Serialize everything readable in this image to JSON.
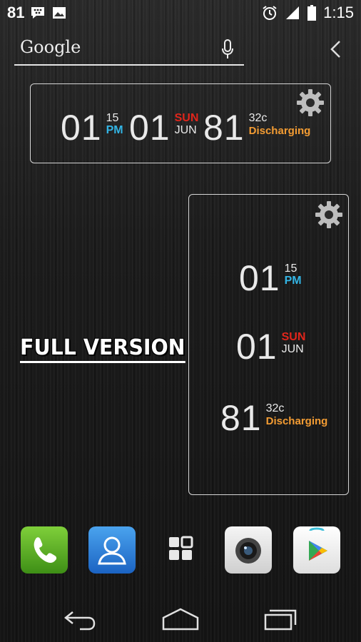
{
  "status_bar": {
    "battery_number": "81",
    "time": "1:15",
    "icons": [
      "bbm-icon",
      "image-icon",
      "alarm-icon",
      "signal-icon",
      "battery-icon"
    ]
  },
  "search": {
    "label": "Google"
  },
  "wide_widget": {
    "hour": "01",
    "minute": "15",
    "ampm": "PM",
    "day": "01",
    "weekday": "SUN",
    "month": "JUN",
    "battery": "81",
    "temp": "32c",
    "status": "Discharging"
  },
  "tall_widget": {
    "hour": "01",
    "minute": "15",
    "ampm": "PM",
    "day": "01",
    "weekday": "SUN",
    "month": "JUN",
    "battery": "81",
    "temp": "32c",
    "status": "Discharging"
  },
  "promo": {
    "label": "FULL VERSION"
  },
  "dock": {
    "apps": [
      "phone-icon",
      "contacts-icon",
      "app-drawer-icon",
      "camera-icon",
      "play-store-icon"
    ]
  },
  "nav": {
    "buttons": [
      "back-icon",
      "home-icon",
      "recents-icon"
    ]
  },
  "colors": {
    "accent_blue": "#33b5e5",
    "accent_red": "#e0251b",
    "accent_orange": "#f39c33"
  }
}
